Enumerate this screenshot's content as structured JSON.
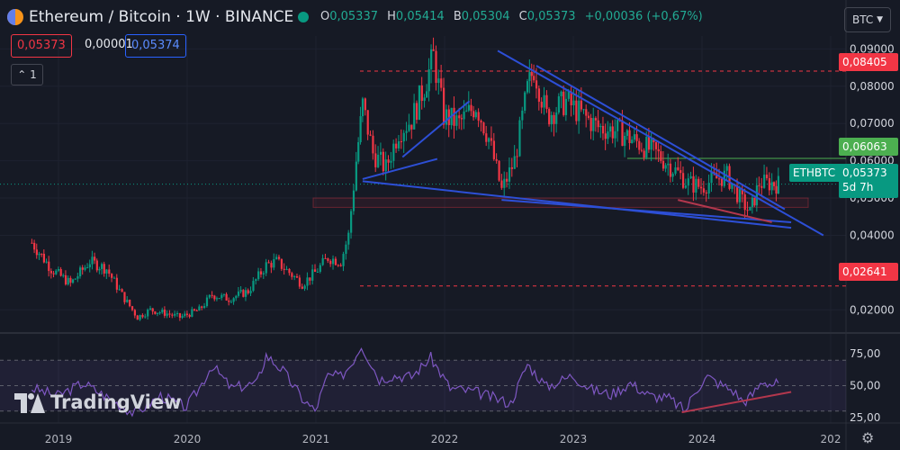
{
  "header": {
    "title": "Ethereum / Bitcoin · 1W · BINANCE",
    "ohlc": {
      "o_label": "O",
      "o": "0,05337",
      "h_label": "H",
      "h": "0,05414",
      "l_label": "B",
      "l": "0,05304",
      "c_label": "C",
      "c": "0,05373",
      "change": "+0,00036 (+0,67%)"
    },
    "sell_price": "0,05373",
    "spread": "0,00001",
    "buy_price": "0,05374",
    "indicators_collapse": "1",
    "currency": "BTC"
  },
  "colors": {
    "background": "#161a25",
    "up": "#089981",
    "down": "#f23645",
    "trendline": "#2d4fd6",
    "green_level": "#4caf50",
    "rsi": "#7e57c2",
    "accent": "#2962ff"
  },
  "tags": {
    "high_level": "0,08405",
    "green_level": "0,06063",
    "symbol": "ETHBTC",
    "last_price": "0,05373",
    "countdown": "5d 7h",
    "low_level": "0,02641"
  },
  "watermark": "TradingView",
  "chart_data": {
    "type": "candlestick",
    "symbol": "ETHBTC",
    "interval": "1W",
    "exchange": "BINANCE",
    "ylim": [
      0.015,
      0.0925
    ],
    "y_ticks": [
      "0,02000",
      "0,04000",
      "0,05000",
      "0,06000",
      "0,07000",
      "0,08000",
      "0,09000"
    ],
    "x_ticks": [
      "2019",
      "2020",
      "2021",
      "2022",
      "2023",
      "2024",
      "202"
    ],
    "price_path": [
      {
        "date": "2018.80",
        "value": 0.038
      },
      {
        "date": "2018.95",
        "value": 0.031
      },
      {
        "date": "2019.10",
        "value": 0.027
      },
      {
        "date": "2019.25",
        "value": 0.033
      },
      {
        "date": "2019.38",
        "value": 0.031
      },
      {
        "date": "2019.50",
        "value": 0.024
      },
      {
        "date": "2019.62",
        "value": 0.018
      },
      {
        "date": "2019.72",
        "value": 0.02
      },
      {
        "date": "2019.85",
        "value": 0.019
      },
      {
        "date": "2019.95",
        "value": 0.018
      },
      {
        "date": "2020.10",
        "value": 0.02
      },
      {
        "date": "2020.20",
        "value": 0.024
      },
      {
        "date": "2020.33",
        "value": 0.023
      },
      {
        "date": "2020.48",
        "value": 0.025
      },
      {
        "date": "2020.62",
        "value": 0.032
      },
      {
        "date": "2020.70",
        "value": 0.033
      },
      {
        "date": "2020.80",
        "value": 0.03
      },
      {
        "date": "2020.90",
        "value": 0.027
      },
      {
        "date": "2021.00",
        "value": 0.03
      },
      {
        "date": "2021.10",
        "value": 0.034
      },
      {
        "date": "2021.20",
        "value": 0.033
      },
      {
        "date": "2021.26",
        "value": 0.04
      },
      {
        "date": "2021.32",
        "value": 0.06
      },
      {
        "date": "2021.37",
        "value": 0.075
      },
      {
        "date": "2021.45",
        "value": 0.062
      },
      {
        "date": "2021.55",
        "value": 0.058
      },
      {
        "date": "2021.65",
        "value": 0.068
      },
      {
        "date": "2021.75",
        "value": 0.071
      },
      {
        "date": "2021.85",
        "value": 0.08
      },
      {
        "date": "2021.92",
        "value": 0.088
      },
      {
        "date": "2022.00",
        "value": 0.072
      },
      {
        "date": "2022.12",
        "value": 0.07
      },
      {
        "date": "2022.25",
        "value": 0.075
      },
      {
        "date": "2022.35",
        "value": 0.066
      },
      {
        "date": "2022.45",
        "value": 0.052
      },
      {
        "date": "2022.55",
        "value": 0.06
      },
      {
        "date": "2022.65",
        "value": 0.079
      },
      {
        "date": "2022.70",
        "value": 0.085
      },
      {
        "date": "2022.80",
        "value": 0.072
      },
      {
        "date": "2022.95",
        "value": 0.076
      },
      {
        "date": "2023.05",
        "value": 0.073
      },
      {
        "date": "2023.20",
        "value": 0.069
      },
      {
        "date": "2023.35",
        "value": 0.068
      },
      {
        "date": "2023.50",
        "value": 0.065
      },
      {
        "date": "2023.65",
        "value": 0.062
      },
      {
        "date": "2023.78",
        "value": 0.058
      },
      {
        "date": "2023.90",
        "value": 0.054
      },
      {
        "date": "2024.00",
        "value": 0.053
      },
      {
        "date": "2024.10",
        "value": 0.055
      },
      {
        "date": "2024.20",
        "value": 0.056
      },
      {
        "date": "2024.30",
        "value": 0.05
      },
      {
        "date": "2024.38",
        "value": 0.046
      },
      {
        "date": "2024.45",
        "value": 0.054
      },
      {
        "date": "2024.55",
        "value": 0.054
      },
      {
        "date": "2024.60",
        "value": 0.05373
      }
    ],
    "horizontal_levels": [
      {
        "value": 0.08405,
        "style": "dashed",
        "color": "#f23645"
      },
      {
        "value": 0.06063,
        "style": "solid",
        "color": "#4caf50"
      },
      {
        "value": 0.05373,
        "style": "dotted",
        "color": "#089981"
      },
      {
        "value": 0.02641,
        "style": "dashed",
        "color": "#f23645"
      }
    ],
    "trendlines": [
      {
        "from": {
          "date": "2022.42",
          "value": 0.0895
        },
        "to": {
          "date": "2024.95",
          "value": 0.04
        },
        "color": "#2d4fd6"
      },
      {
        "from": {
          "date": "2022.72",
          "value": 0.0855
        },
        "to": {
          "date": "2024.65",
          "value": 0.047
        },
        "color": "#2d4fd6"
      },
      {
        "from": {
          "date": "2021.37",
          "value": 0.0545
        },
        "to": {
          "date": "2024.70",
          "value": 0.042
        },
        "color": "#2d4fd6"
      },
      {
        "from": {
          "date": "2022.45",
          "value": 0.0495
        },
        "to": {
          "date": "2024.70",
          "value": 0.0435
        },
        "color": "#2d4fd6"
      },
      {
        "from": {
          "date": "2021.37",
          "value": 0.0551
        },
        "to": {
          "date": "2021.95",
          "value": 0.0605
        },
        "color": "#2d4fd6"
      },
      {
        "from": {
          "date": "2021.68",
          "value": 0.061
        },
        "to": {
          "date": "2022.20",
          "value": 0.076
        },
        "color": "#2d4fd6"
      },
      {
        "from": {
          "date": "2023.82",
          "value": 0.0495
        },
        "to": {
          "date": "2024.55",
          "value": 0.0435
        },
        "color": "#b2374d"
      }
    ],
    "rsi": {
      "ylim": [
        22,
        90
      ],
      "y_ticks": [
        "25,00",
        "50,00",
        "75,00"
      ],
      "band": [
        30,
        70
      ],
      "path": [
        {
          "date": "2018.80",
          "value": 48
        },
        {
          "date": "2019.00",
          "value": 42
        },
        {
          "date": "2019.20",
          "value": 52
        },
        {
          "date": "2019.40",
          "value": 40
        },
        {
          "date": "2019.60",
          "value": 28
        },
        {
          "date": "2019.80",
          "value": 42
        },
        {
          "date": "2020.00",
          "value": 33
        },
        {
          "date": "2020.10",
          "value": 48
        },
        {
          "date": "2020.20",
          "value": 66
        },
        {
          "date": "2020.35",
          "value": 48
        },
        {
          "date": "2020.55",
          "value": 52
        },
        {
          "date": "2020.62",
          "value": 74
        },
        {
          "date": "2020.75",
          "value": 62
        },
        {
          "date": "2020.90",
          "value": 40
        },
        {
          "date": "2021.00",
          "value": 30
        },
        {
          "date": "2021.10",
          "value": 58
        },
        {
          "date": "2021.20",
          "value": 57
        },
        {
          "date": "2021.28",
          "value": 67
        },
        {
          "date": "2021.36",
          "value": 82
        },
        {
          "date": "2021.50",
          "value": 55
        },
        {
          "date": "2021.60",
          "value": 58
        },
        {
          "date": "2021.75",
          "value": 57
        },
        {
          "date": "2021.90",
          "value": 72
        },
        {
          "date": "2022.05",
          "value": 48
        },
        {
          "date": "2022.25",
          "value": 45
        },
        {
          "date": "2022.40",
          "value": 40
        },
        {
          "date": "2022.52",
          "value": 36
        },
        {
          "date": "2022.65",
          "value": 67
        },
        {
          "date": "2022.80",
          "value": 49
        },
        {
          "date": "2023.00",
          "value": 58
        },
        {
          "date": "2023.15",
          "value": 47
        },
        {
          "date": "2023.30",
          "value": 43
        },
        {
          "date": "2023.45",
          "value": 52
        },
        {
          "date": "2023.60",
          "value": 42
        },
        {
          "date": "2023.75",
          "value": 40
        },
        {
          "date": "2023.88",
          "value": 30
        },
        {
          "date": "2023.95",
          "value": 46
        },
        {
          "date": "2024.05",
          "value": 57
        },
        {
          "date": "2024.15",
          "value": 51
        },
        {
          "date": "2024.25",
          "value": 46
        },
        {
          "date": "2024.33",
          "value": 37
        },
        {
          "date": "2024.40",
          "value": 43
        },
        {
          "date": "2024.48",
          "value": 54
        },
        {
          "date": "2024.55",
          "value": 51
        },
        {
          "date": "2024.60",
          "value": 52
        }
      ],
      "trendline": {
        "from": {
          "date": "2023.85",
          "value": 29
        },
        "to": {
          "date": "2024.70",
          "value": 45
        },
        "color": "#b2374d"
      }
    }
  }
}
